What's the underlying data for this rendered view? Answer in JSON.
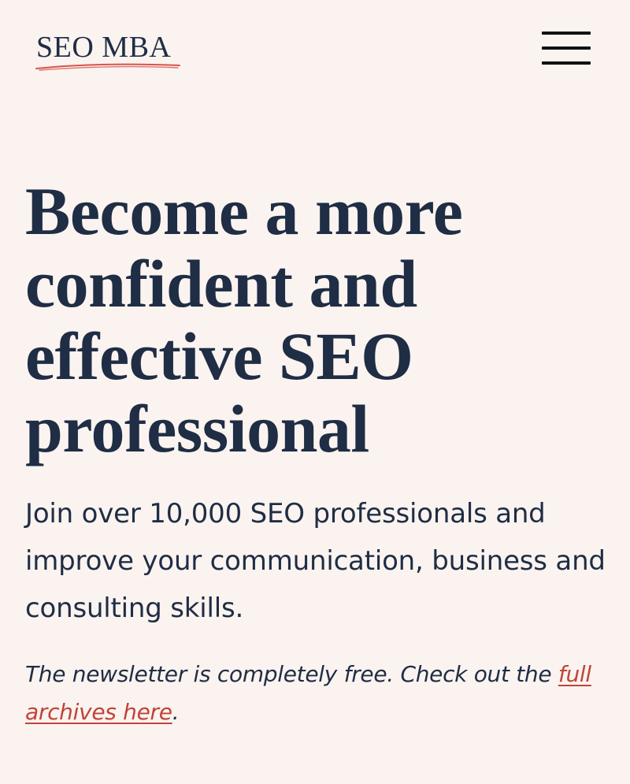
{
  "header": {
    "logo_text": "SEO MBA",
    "menu_icon": "hamburger-menu-icon",
    "accent_color": "#d9534f"
  },
  "hero": {
    "headline_lines": [
      "Become a more",
      "confident and",
      "effective SEO",
      "professional"
    ],
    "lede": "Join over 10,000 SEO professionals and improve your communication, business and consulting skills.",
    "note_prefix": "The newsletter is completely free. Check out the ",
    "archive_link_label": "full archives here",
    "note_suffix": "."
  },
  "colors": {
    "background": "#faf3ef",
    "text": "#1f2d45",
    "link": "#c0443a"
  }
}
